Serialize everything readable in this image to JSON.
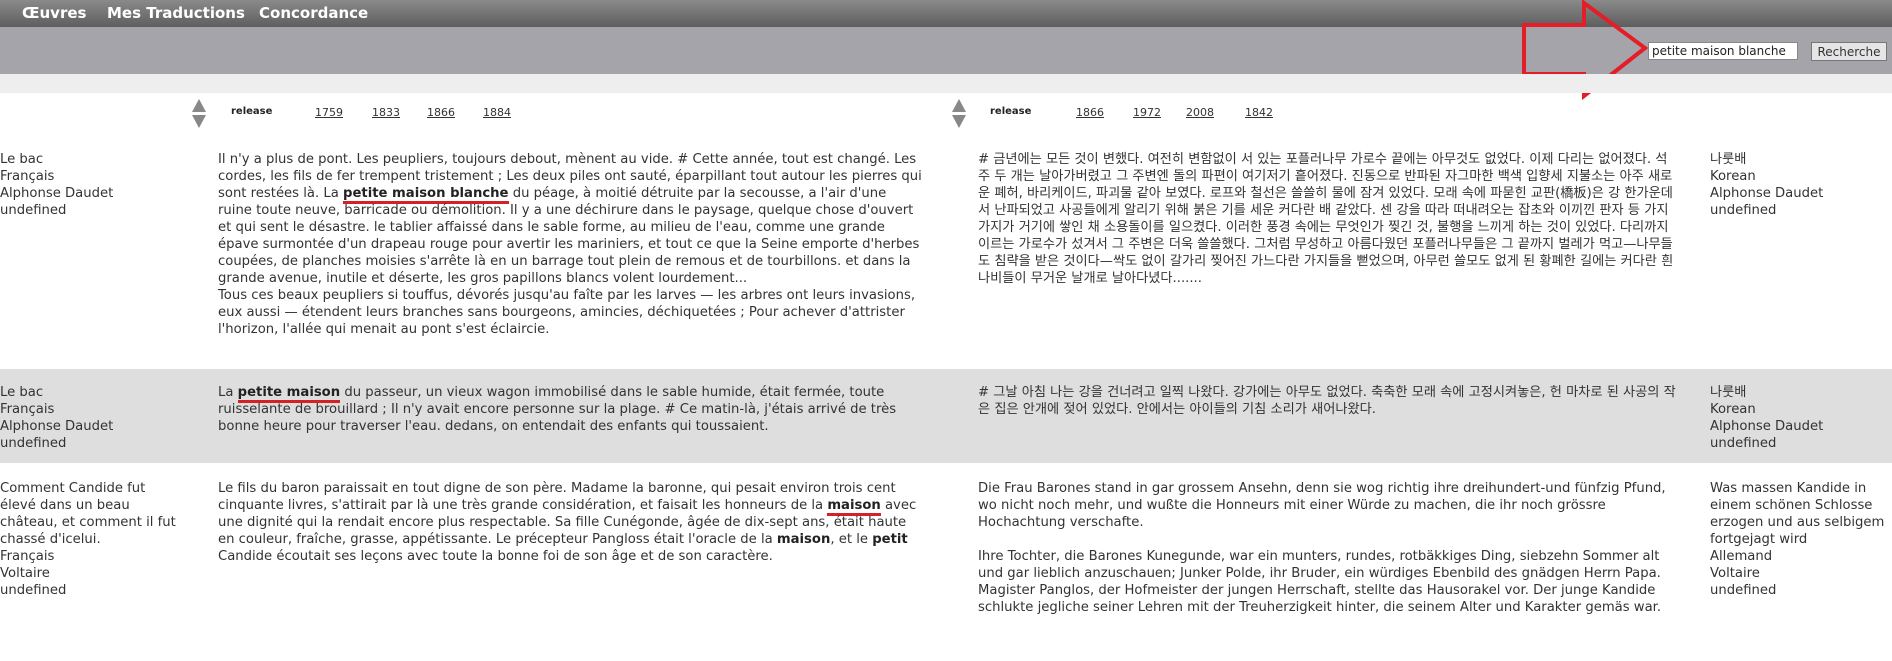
{
  "nav": {
    "items": [
      "Œuvres",
      "Mes Traductions",
      "Concordance"
    ]
  },
  "search": {
    "value": "petite maison blanche",
    "button_label": "Recherche"
  },
  "columns": {
    "left": {
      "release_label": "release",
      "years": [
        "1759",
        "1833",
        "1866",
        "1884"
      ]
    },
    "right": {
      "release_label": "release",
      "years": [
        "1866",
        "1972",
        "2008",
        "1842"
      ]
    }
  },
  "rows": [
    {
      "meta_left": [
        "Le bac",
        "Français",
        "Alphonse Daudet",
        "undefined"
      ],
      "text_fr": {
        "a": "Il n'y a plus de pont. Les peupliers, toujours debout, mènent au vide. # Cette année, tout est changé. Les cordes, les fils de fer trempent tristement ; Les deux piles ont sauté, éparpillant tout autour les pierres qui sont restées là. La ",
        "hl": "petite maison blanche",
        "b": " du péage, à moitié détruite par la secousse, a l'air d'une ruine toute neuve, barricade ou démolition. Il y a une déchirure dans le paysage, quelque chose d'ouvert et qui sent le désastre. le tablier affaissé dans le sable forme, au milieu de l'eau, comme une grande épave surmontée d'un drapeau rouge pour avertir les mariniers, et tout ce que la Seine emporte d'herbes coupées, de planches moisies s'arrête là en un barrage tout plein de remous et de tourbillons. et dans la grande avenue, inutile et déserte, les gros papillons blancs volent lourdement...",
        "p2": "Tous ces beaux peupliers si touffus, dévorés jusqu'au faîte par les larves — les arbres ont leurs invasions, eux aussi — étendent leurs branches sans bourgeons, amincies, déchiquetées ; Pour achever d'attrister l'horizon, l'allée qui menait au pont s'est éclaircie."
      },
      "text_tr": "# 금년에는 모든 것이 변했다. 여전히 변함없이 서 있는 포플러나무 가로수 끝에는 아무것도 없었다. 이제 다리는 없어졌다. 석주 두 개는 날아가버렸고 그 주변엔 돌의 파편이 여기저기 흩어졌다. 진동으로 반파된 자그마한 백색 입향세 지불소는 아주 새로운 폐허, 바리케이드, 파괴물 같아 보였다. 로프와 철선은 쓸쓸히 물에 잠겨 있었다. 모래 속에 파묻힌 교판(橋板)은 강 한가운데서 난파되었고 사공들에게 알리기 위해 붉은 기를 세운 커다란 배 같았다. 센 강을 따라 떠내려오는 잡초와 이끼낀 판자 등 가지가지가 거기에 쌓인 채 소용돌이를 일으켰다. 이러한 풍경 속에는 무엇인가 찢긴 것, 불행을 느끼게 하는 것이 있었다. 다리까지 이르는 가로수가 섰겨서 그 주변은 더욱 쓸쓸했다. 그처럼 무성하고 아름다웠던 포플러나무들은 그 끝까지 벌레가 먹고—나무들도 침략을 받은 것이다—싹도 없이 갈가리 찢어진 가느다란 가지들을 뻗었으며, 아무런 쓸모도 없게 된 황폐한 길에는 커다란 흰나비들이 무거운 날개로 날아다녔다.......",
      "meta_right": [
        "나룻배",
        "Korean",
        "Alphonse Daudet",
        "undefined"
      ]
    },
    {
      "meta_left": [
        "Le bac",
        "Français",
        "Alphonse Daudet",
        "undefined"
      ],
      "text_fr": {
        "a": "La ",
        "hl": "petite maison",
        "b": " du passeur, un vieux wagon immobilisé dans le sable humide, était fermée, toute ruisselante de brouillard ; Il n'y avait encore personne sur la plage. # Ce matin-là, j'étais arrivé de très bonne heure pour traverser l'eau. dedans, on entendait des enfants qui toussaient."
      },
      "text_tr": "# 그날 아침 나는 강을 건너려고 일찍 나왔다. 강가에는 아무도 없었다. 축축한 모래 속에 고정시켜놓은, 헌 마차로 된 사공의 작은 집은 안개에 젖어 있었다. 안에서는 아이들의 기침 소리가 새어나왔다.",
      "meta_right": [
        "나룻배",
        "Korean",
        "Alphonse Daudet",
        "undefined"
      ]
    },
    {
      "meta_left": [
        "Comment Candide fut",
        "élevé dans un beau",
        "château, et comment il fut",
        "chassé d'icelui.",
        "Français",
        "Voltaire",
        "undefined"
      ],
      "text_fr": {
        "a": "Le fils du baron paraissait en tout digne de son père. Madame la baronne, qui pesait environ trois cent cinquante livres, s'attirait par là une très grande considération, et faisait les honneurs de la ",
        "hl": "maison",
        "b": " avec une dignité qui la rendait encore plus respectable. Sa fille Cunégonde, âgée de dix-sept ans, était haute en couleur, fraîche, grasse, appétissante. Le précepteur Pangloss était l'oracle de la ",
        "b1": "maison",
        "c": ", et le ",
        "b2": "petit",
        "d": " Candide écoutait ses leçons avec toute la bonne foi de son âge et de son caractère."
      },
      "text_tr_p1": "Die Frau Barones stand in gar grossem Ansehn, denn sie wog richtig ihre dreihundert-und fünfzig Pfund, wo nicht noch mehr, und wußte die Honneurs mit einer Würde zu machen, die ihr noch grössre Hochachtung verschafte.",
      "text_tr_p2": "Ihre Tochter, die Barones Kunegunde, war ein munters, rundes, rotbäkkiges Ding, siebzehn Sommer alt und gar lieblich anzuschauen; Junker Polde, ihr Bruder, ein würdiges Ebenbild des gnädgen Herrn Papa. Magister Panglos, der Hofmeister der jungen Herrschaft, stellte das Hausorakel vor. Der junge Kandide schlukte jegliche seiner Lehren mit der Treuherzigkeit hinter, die seinem Alter und Karakter gemäs war.",
      "meta_right": [
        "Was massen Kandide in",
        "einem schönen Schlosse",
        "erzogen und aus selbigem",
        "fortgejagt wird",
        "Allemand",
        "Voltaire",
        "undefined"
      ]
    }
  ],
  "colors": {
    "highlight": "#d42027",
    "nav_bg": "#6e6e6e",
    "search_bg": "#a6a4ab",
    "row_alt": "#dedede"
  },
  "icons": [
    "arrow-annotation-icon",
    "sort-up-icon",
    "sort-down-icon"
  ]
}
